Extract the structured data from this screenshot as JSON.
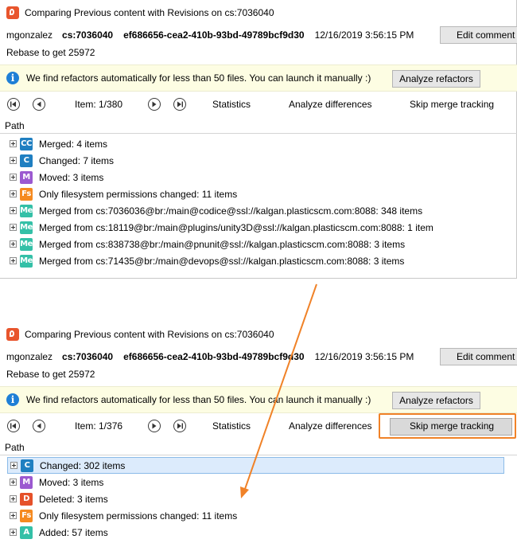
{
  "top": {
    "title": "Comparing Previous content with Revisions on cs:7036040",
    "user": "mgonzalez",
    "changeset": "cs:7036040",
    "guid": "ef686656-cea2-410b-93bd-49789bcf9d30",
    "date": "12/16/2019 3:56:15 PM",
    "edit_comment_label": "Edit comment",
    "comment": "Rebase to get 25972",
    "info_text": "We find refactors automatically for less than 50 files. You can launch it manually :)",
    "analyze_refactors_label": "Analyze refactors",
    "item_position": "Item: 1/380",
    "statistics_label": "Statistics",
    "analyze_differences_label": "Analyze differences",
    "skip_merge_label": "Skip merge tracking",
    "path_header": "Path",
    "rows": [
      {
        "badge": "CC",
        "color": "#1f7fc1",
        "label": "Merged: 4 items"
      },
      {
        "badge": "C",
        "color": "#1f7fc1",
        "label": "Changed: 7 items"
      },
      {
        "badge": "M",
        "color": "#9b59d0",
        "label": "Moved: 3 items"
      },
      {
        "badge": "Fs",
        "color": "#f58a20",
        "label": "Only filesystem permissions changed: 11 items"
      },
      {
        "badge": "Me",
        "color": "#34c0a7",
        "label": "Merged from cs:7036036@br:/main@codice@ssl://kalgan.plasticscm.com:8088: 348 items"
      },
      {
        "badge": "Me",
        "color": "#34c0a7",
        "label": "Merged from cs:18119@br:/main@plugins/unity3D@ssl://kalgan.plasticscm.com:8088: 1 item"
      },
      {
        "badge": "Me",
        "color": "#34c0a7",
        "label": "Merged from cs:838738@br:/main@pnunit@ssl://kalgan.plasticscm.com:8088: 3 items"
      },
      {
        "badge": "Me",
        "color": "#34c0a7",
        "label": "Merged from cs:71435@br:/main@devops@ssl://kalgan.plasticscm.com:8088: 3 items"
      }
    ]
  },
  "bottom": {
    "title": "Comparing Previous content with Revisions on cs:7036040",
    "user": "mgonzalez",
    "changeset": "cs:7036040",
    "guid": "ef686656-cea2-410b-93bd-49789bcf9d30",
    "date": "12/16/2019 3:56:15 PM",
    "edit_comment_label": "Edit comment",
    "comment": "Rebase to get 25972",
    "info_text": "We find refactors automatically for less than 50 files. You can launch it manually :)",
    "analyze_refactors_label": "Analyze refactors",
    "item_position": "Item: 1/376",
    "statistics_label": "Statistics",
    "analyze_differences_label": "Analyze differences",
    "skip_merge_label": "Skip merge tracking",
    "path_header": "Path",
    "rows": [
      {
        "badge": "C",
        "color": "#1f7fc1",
        "label": "Changed: 302 items"
      },
      {
        "badge": "M",
        "color": "#9b59d0",
        "label": "Moved: 3 items"
      },
      {
        "badge": "D",
        "color": "#e5512a",
        "label": "Deleted: 3 items"
      },
      {
        "badge": "Fs",
        "color": "#f58a20",
        "label": "Only filesystem permissions changed: 11 items"
      },
      {
        "badge": "A",
        "color": "#34c0a7",
        "label": "Added: 57 items"
      }
    ]
  },
  "annotation": {
    "arrow_color": "#f08228",
    "highlight_color": "#f08228"
  }
}
